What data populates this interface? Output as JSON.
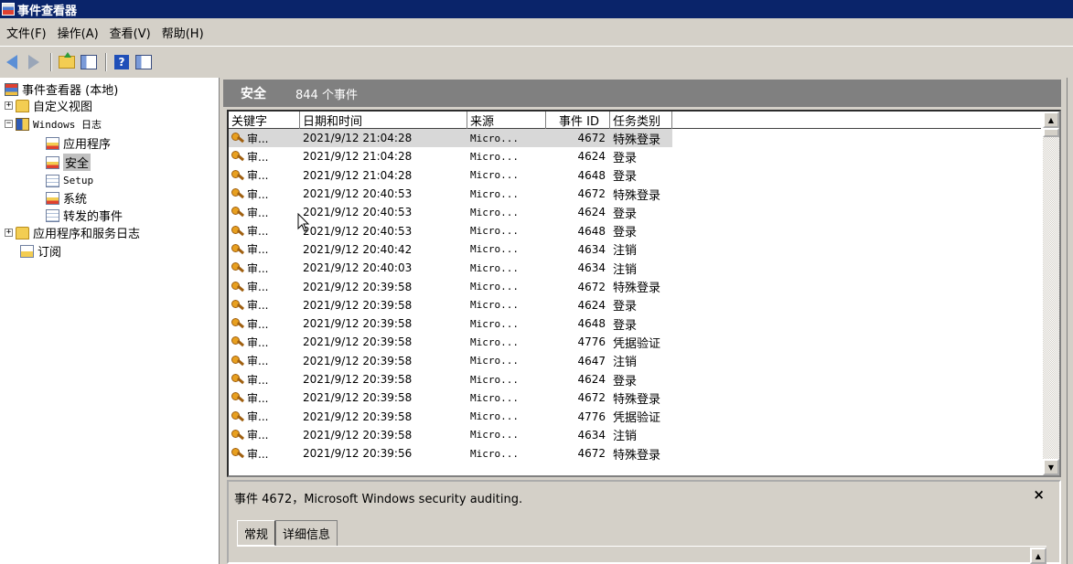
{
  "window": {
    "title": "事件查看器"
  },
  "menu": [
    "文件(F)",
    "操作(A)",
    "查看(V)",
    "帮助(H)"
  ],
  "tree": {
    "root": "事件查看器 (本地)",
    "custom_views": "自定义视图",
    "windows_logs": "Windows 日志",
    "application": "应用程序",
    "security": "安全",
    "setup": "Setup",
    "system": "系统",
    "forwarded": "转发的事件",
    "app_service_logs": "应用程序和服务日志",
    "subscriptions": "订阅"
  },
  "header": {
    "log_name": "安全",
    "event_count": "844 个事件"
  },
  "columns": [
    "关键字",
    "日期和时间",
    "来源",
    "事件 ID",
    "任务类别"
  ],
  "events": [
    {
      "keyword": "审...",
      "datetime": "2021/9/12 21:04:28",
      "source": "Micro...",
      "id": "4672",
      "task": "特殊登录"
    },
    {
      "keyword": "审...",
      "datetime": "2021/9/12 21:04:28",
      "source": "Micro...",
      "id": "4624",
      "task": "登录"
    },
    {
      "keyword": "审...",
      "datetime": "2021/9/12 21:04:28",
      "source": "Micro...",
      "id": "4648",
      "task": "登录"
    },
    {
      "keyword": "审...",
      "datetime": "2021/9/12 20:40:53",
      "source": "Micro...",
      "id": "4672",
      "task": "特殊登录"
    },
    {
      "keyword": "审...",
      "datetime": "2021/9/12 20:40:53",
      "source": "Micro...",
      "id": "4624",
      "task": "登录"
    },
    {
      "keyword": "审...",
      "datetime": "2021/9/12 20:40:53",
      "source": "Micro...",
      "id": "4648",
      "task": "登录"
    },
    {
      "keyword": "审...",
      "datetime": "2021/9/12 20:40:42",
      "source": "Micro...",
      "id": "4634",
      "task": "注销"
    },
    {
      "keyword": "审...",
      "datetime": "2021/9/12 20:40:03",
      "source": "Micro...",
      "id": "4634",
      "task": "注销"
    },
    {
      "keyword": "审...",
      "datetime": "2021/9/12 20:39:58",
      "source": "Micro...",
      "id": "4672",
      "task": "特殊登录"
    },
    {
      "keyword": "审...",
      "datetime": "2021/9/12 20:39:58",
      "source": "Micro...",
      "id": "4624",
      "task": "登录"
    },
    {
      "keyword": "审...",
      "datetime": "2021/9/12 20:39:58",
      "source": "Micro...",
      "id": "4648",
      "task": "登录"
    },
    {
      "keyword": "审...",
      "datetime": "2021/9/12 20:39:58",
      "source": "Micro...",
      "id": "4776",
      "task": "凭据验证"
    },
    {
      "keyword": "审...",
      "datetime": "2021/9/12 20:39:58",
      "source": "Micro...",
      "id": "4647",
      "task": "注销"
    },
    {
      "keyword": "审...",
      "datetime": "2021/9/12 20:39:58",
      "source": "Micro...",
      "id": "4624",
      "task": "登录"
    },
    {
      "keyword": "审...",
      "datetime": "2021/9/12 20:39:58",
      "source": "Micro...",
      "id": "4672",
      "task": "特殊登录"
    },
    {
      "keyword": "审...",
      "datetime": "2021/9/12 20:39:58",
      "source": "Micro...",
      "id": "4776",
      "task": "凭据验证"
    },
    {
      "keyword": "审...",
      "datetime": "2021/9/12 20:39:58",
      "source": "Micro...",
      "id": "4634",
      "task": "注销"
    },
    {
      "keyword": "审...",
      "datetime": "2021/9/12 20:39:56",
      "source": "Micro...",
      "id": "4672",
      "task": "特殊登录"
    }
  ],
  "detail": {
    "title": "事件 4672，Microsoft Windows security auditing.",
    "close": "×",
    "tabs": [
      "常规",
      "详细信息"
    ]
  }
}
